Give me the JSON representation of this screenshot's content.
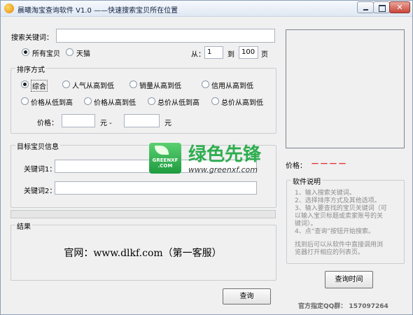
{
  "window": {
    "title": "晨曦淘宝查询软件 V1.0  ——快速搜索宝贝所在位置"
  },
  "search": {
    "keyword_label": "搜索关键词：",
    "keyword_value": "",
    "scope_options": [
      {
        "label": "所有宝贝",
        "selected": true
      },
      {
        "label": "天猫",
        "selected": false
      }
    ],
    "page_from_label": "从：",
    "page_from": "1",
    "page_to_label": "到",
    "page_to": "100",
    "page_unit": "页"
  },
  "sort": {
    "legend": "排序方式",
    "options": [
      {
        "label": "综合",
        "selected": true
      },
      {
        "label": "人气从高到低",
        "selected": false
      },
      {
        "label": "销量从高到低",
        "selected": false
      },
      {
        "label": "信用从高到低",
        "selected": false
      },
      {
        "label": "价格从低到高",
        "selected": false
      },
      {
        "label": "价格从高到低",
        "selected": false
      },
      {
        "label": "总价从低到高",
        "selected": false
      },
      {
        "label": "总价从高到低",
        "selected": false
      }
    ],
    "price_label": "价格：",
    "price_min": "",
    "price_separator": "元 -",
    "price_max": "",
    "price_unit": "元"
  },
  "target": {
    "legend": "目标宝贝信息",
    "keyword1_label": "关键词1：",
    "keyword1_value": "",
    "keyword2_label": "关键词2：",
    "keyword2_value": ""
  },
  "result": {
    "legend": "结果",
    "text": "官网：www.dlkf.com（第一客服）"
  },
  "query_button": "查询",
  "right_panel": {
    "price_label": "价格：",
    "price_value": "－－－－",
    "help_legend": "软件说明",
    "help_lines": [
      "1、输入搜索关键词。",
      "2、选择排序方式及其他选项。",
      "3、输入要查找的宝贝关键词（可",
      "以输入宝贝标题或卖家账号的关",
      "键词）。",
      "4、点“查询”按钮开始搜索。",
      "",
      "找到后可以从软件中直接调用浏",
      "览器打开相应的列表页。"
    ],
    "query_time_button": "查询时间",
    "qq_group_text": "官方指定QQ群： 157097264"
  },
  "watermark": {
    "logo_text": "GREENXF\n.COM",
    "title": "绿色先锋",
    "url": "www.greenxf.com"
  },
  "colors": {
    "price_value": "#e23030",
    "help_text": "#8c8c8c",
    "watermark_green": "#2eae4f"
  }
}
